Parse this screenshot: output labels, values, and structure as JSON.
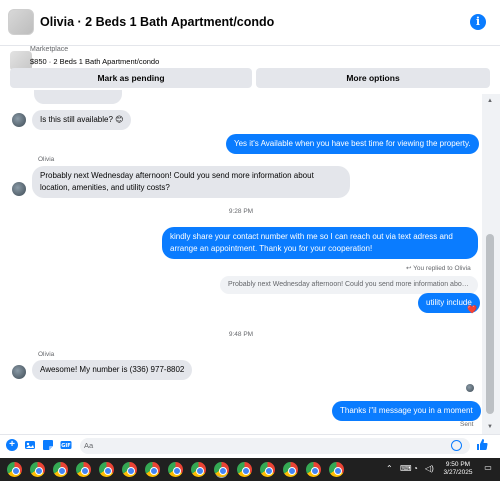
{
  "header": {
    "title": "Olivia · 2 Beds 1 Bath Apartment/condo",
    "info_icon": "info-icon",
    "info_glyph": "i"
  },
  "listing": {
    "source": "Marketplace",
    "price_title": "$850 · 2 Beds 1 Bath Apartment/condo",
    "mark_pending_label": "Mark as pending",
    "more_options_label": "More options"
  },
  "messages": {
    "m1": "Is this still available? 😊",
    "m2": "Yes it's Available when you have best time for viewing the property.",
    "sender_1": "Olivia",
    "m3": "Probably next Wednesday afternoon! Could you send more information about location, amenities, and utility costs?",
    "time_1": "9:28 PM",
    "m4": "kindly share your contact number with me so I can reach out via text adress and arrange an appointment. Thank you for your cooperation!",
    "replied_label": "↩ You replied to Olivia",
    "quoted": "Probably next Wednesday afternoon! Could you send more information about...",
    "m5": "utility include",
    "reaction": "❤️",
    "time_2": "9:48 PM",
    "sender_2": "Olivia",
    "m6": "Awesome! My number is (336) 977-8802",
    "m7": "Thanks i\"il message you in a moment",
    "status": "Sent"
  },
  "composer": {
    "placeholder": "Aa",
    "icons": [
      "plus-icon",
      "photo-icon",
      "sticker-icon",
      "gif-icon",
      "emoji-icon",
      "thumbs-up-icon"
    ]
  },
  "taskbar": {
    "time": "9:50 PM",
    "date": "3/27/2025",
    "app_icons_count": 15
  },
  "colors": {
    "accent": "#0a7cff",
    "incoming_bubble": "#e4e6eb",
    "taskbar": "#202020"
  }
}
